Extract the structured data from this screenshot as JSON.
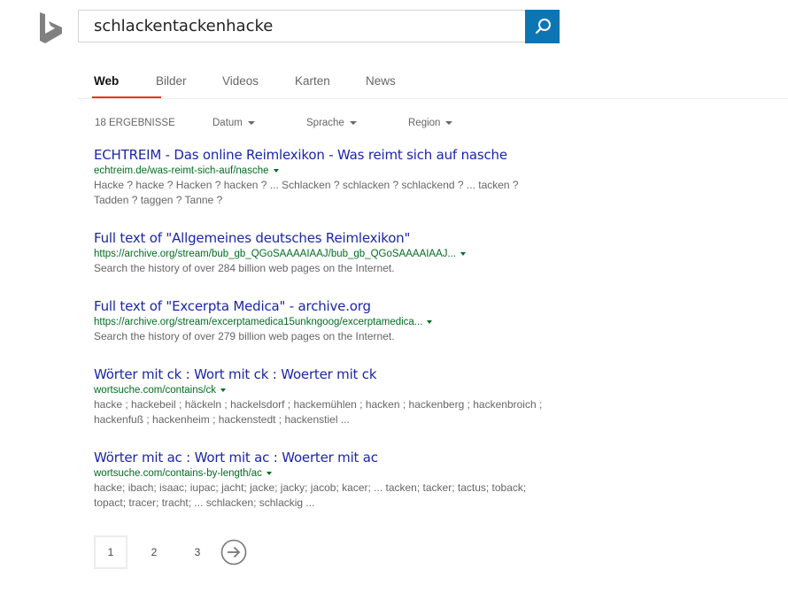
{
  "search": {
    "query": "schlackentackenhacke",
    "button_icon": "search-icon"
  },
  "logo": "bing-logo-icon",
  "tabs": [
    {
      "label": "Web",
      "active": true
    },
    {
      "label": "Bilder",
      "active": false
    },
    {
      "label": "Videos",
      "active": false
    },
    {
      "label": "Karten",
      "active": false
    },
    {
      "label": "News",
      "active": false
    }
  ],
  "filters": {
    "count": "18 ERGEBNISSE",
    "date": "Datum",
    "language": "Sprache",
    "region": "Region"
  },
  "results": [
    {
      "title": "ECHTREIM - Das online Reimlexikon - Was reimt sich auf nasche",
      "url": "echtreim.de/was-reimt-sich-auf/nasche",
      "snippet": "Hacke ? hacke ? Hacken ? hacken ? ... Schlacken ? schlacken ? schlackend ? ... tacken ? Tadden ? taggen ? Tanne ?"
    },
    {
      "title": "Full text of \"Allgemeines deutsches Reimlexikon\"",
      "url": "https://archive.org/stream/bub_gb_QGoSAAAAIAAJ/bub_gb_QGoSAAAAIAAJ...",
      "snippet": "Search the history of over 284 billion web pages on the Internet."
    },
    {
      "title": "Full text of \"Excerpta Medica\" - archive.org",
      "url": "https://archive.org/stream/excerptamedica15unkngoog/excerptamedica...",
      "snippet": "Search the history of over 279 billion web pages on the Internet."
    },
    {
      "title": "Wörter mit ck : Wort mit ck : Woerter mit ck",
      "url": "wortsuche.com/contains/ck",
      "snippet": "hacke ; hackebeil ; häckeln ; hackelsdorf ; hackemühlen ; hacken ; hackenberg ; hackenbroich ; hackenfuß ; hackenheim ; hackenstedt ; hackenstiel ..."
    },
    {
      "title": "Wörter mit ac : Wort mit ac : Woerter mit ac",
      "url": "wortsuche.com/contains-by-length/ac",
      "snippet": "hacke; ibach; isaac; iupac; jacht; jacke; jacky; jacob; kacer; ... tacken; tacker; tactus; toback; topact; tracer; tracht; ... schlacken; schlackig ..."
    }
  ],
  "pagination": {
    "pages": [
      "1",
      "2",
      "3"
    ],
    "current": "1",
    "next_icon": "arrow-right-circle-icon"
  }
}
